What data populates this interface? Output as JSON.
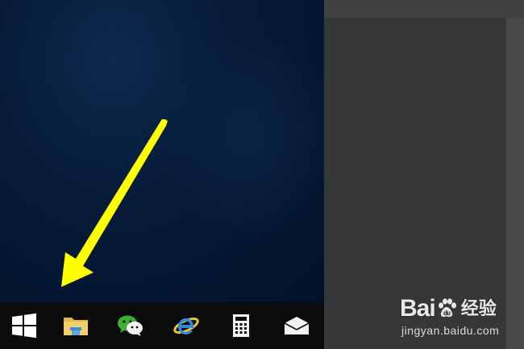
{
  "taskbar": {
    "items": [
      {
        "name": "start-button",
        "icon": "windows-logo-icon"
      },
      {
        "name": "file-explorer",
        "icon": "folder-icon"
      },
      {
        "name": "wechat",
        "icon": "wechat-icon"
      },
      {
        "name": "internet-explorer",
        "icon": "ie-icon"
      },
      {
        "name": "calculator",
        "icon": "calculator-icon"
      },
      {
        "name": "mail",
        "icon": "mail-icon"
      }
    ]
  },
  "annotation": {
    "icon": "yellow-arrow-pointing-to-start",
    "color": "#ffff00"
  },
  "watermark": {
    "brand_left": "Bai",
    "brand_right": "du",
    "brand_cn": "经验",
    "domain": "jingyan.baidu.com"
  },
  "colors": {
    "desktop": "#041a36",
    "taskbar": "#0b0b0b",
    "right_pane": "#383a3c",
    "arrow": "#ffff00"
  }
}
